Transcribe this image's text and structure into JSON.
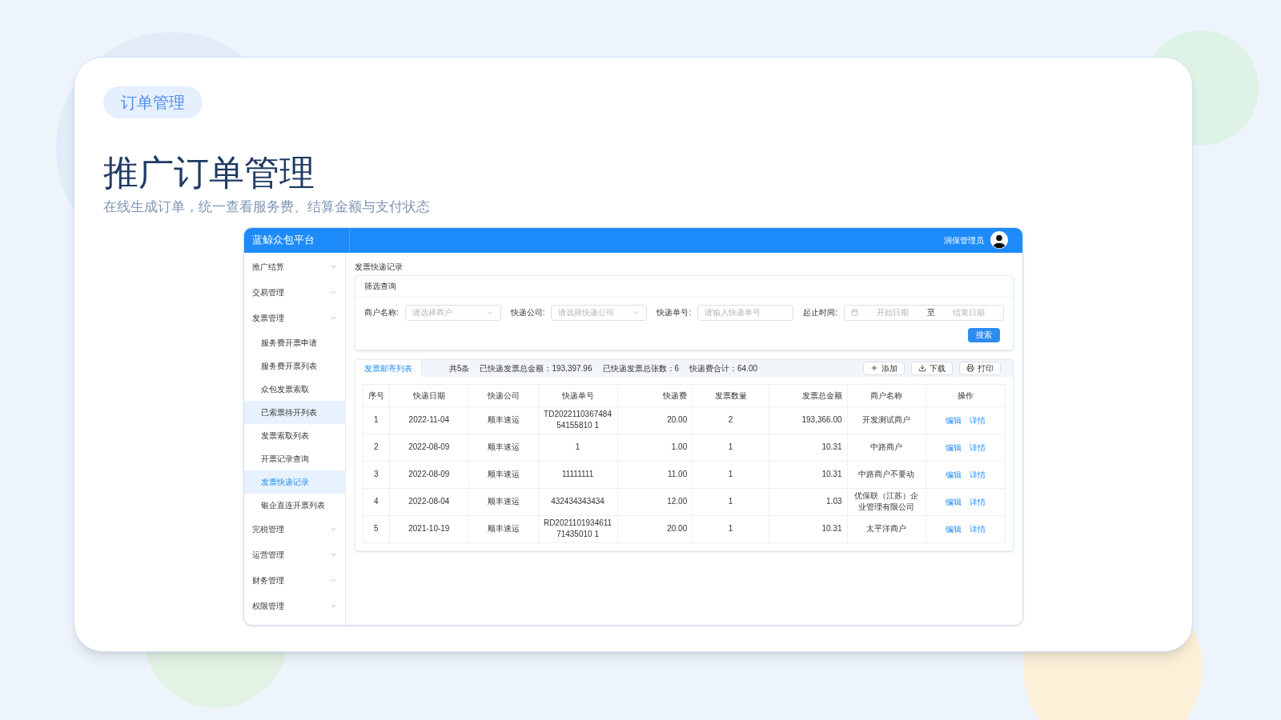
{
  "slide": {
    "badge": "订单管理",
    "title": "推广订单管理",
    "subtitle": "在线生成订单，统一查看服务费、结算金额与支付状态"
  },
  "app": {
    "brand": "蓝鲸众包平台",
    "user": "润保管理员",
    "sidebar": [
      {
        "label": "推广结算",
        "expanded": false
      },
      {
        "label": "交易管理",
        "expanded": false
      },
      {
        "label": "发票管理",
        "expanded": true,
        "children": [
          {
            "label": "服务费开票申请",
            "selected": false,
            "highlighted": false
          },
          {
            "label": "服务费开票列表",
            "selected": false,
            "highlighted": false
          },
          {
            "label": "众包发票索取",
            "selected": false,
            "highlighted": false
          },
          {
            "label": "已索票待开列表",
            "selected": false,
            "highlighted": true
          },
          {
            "label": "发票索取列表",
            "selected": false,
            "highlighted": false
          },
          {
            "label": "开票记录查询",
            "selected": false,
            "highlighted": false
          },
          {
            "label": "发票快递记录",
            "selected": true,
            "highlighted": true
          },
          {
            "label": "银企直连开票列表",
            "selected": false,
            "highlighted": false
          }
        ]
      },
      {
        "label": "完税管理",
        "expanded": false
      },
      {
        "label": "运营管理",
        "expanded": false
      },
      {
        "label": "财务管理",
        "expanded": false
      },
      {
        "label": "权限管理",
        "expanded": false
      }
    ],
    "page_title": "发票快递记录",
    "filter": {
      "title": "筛选查询",
      "fields": [
        {
          "kind": "select",
          "label": "商户名称:",
          "placeholder": "请选择商户"
        },
        {
          "kind": "select",
          "label": "快递公司:",
          "placeholder": "请选择快递公司"
        },
        {
          "kind": "input",
          "label": "快递单号:",
          "placeholder": "请输入快递单号"
        },
        {
          "kind": "daterange",
          "label": "起止时间:",
          "placeholder": "开始日期",
          "separator": "至",
          "placeholder_end": "结束日期"
        }
      ],
      "search_button": "搜索"
    },
    "list": {
      "tab": "发票邮寄列表",
      "summary": [
        "共5条",
        "已快递发票总金额：193,397.96",
        "已快递发票总张数：6",
        "快递费合计：64.00"
      ],
      "actions": [
        "添加",
        "下载",
        "打印"
      ],
      "columns": [
        "序号",
        "快递日期",
        "快递公司",
        "快递单号",
        "快递费",
        "发票数量",
        "发票总金额",
        "商户名称",
        "操作"
      ],
      "rows": [
        {
          "cells": [
            "1",
            "2022-11-04",
            "顺丰速运",
            "TD202211036748454155810 1",
            "20.00",
            "2",
            "193,366.00",
            "开发测试商户"
          ],
          "ops": [
            "编辑",
            "详情"
          ]
        },
        {
          "cells": [
            "2",
            "2022-08-09",
            "顺丰速运",
            "1",
            "1.00",
            "1",
            "10.31",
            "中路商户"
          ],
          "ops": [
            "编辑",
            "详情"
          ]
        },
        {
          "cells": [
            "3",
            "2022-08-09",
            "顺丰速运",
            "11111111",
            "11.00",
            "1",
            "10.31",
            "中路商户不要动"
          ],
          "ops": [
            "编辑",
            "详情"
          ]
        },
        {
          "cells": [
            "4",
            "2022-08-04",
            "顺丰速运",
            "432434343434",
            "12.00",
            "1",
            "1.03",
            "优保联（江苏）企业管理有限公司"
          ],
          "ops": [
            "编辑",
            "详情"
          ]
        },
        {
          "cells": [
            "5",
            "2021-10-19",
            "顺丰速运",
            "RD202110193461171435010 1",
            "20.00",
            "1",
            "10.31",
            "太平洋商户"
          ],
          "ops": [
            "编辑",
            "详情"
          ]
        }
      ]
    }
  }
}
